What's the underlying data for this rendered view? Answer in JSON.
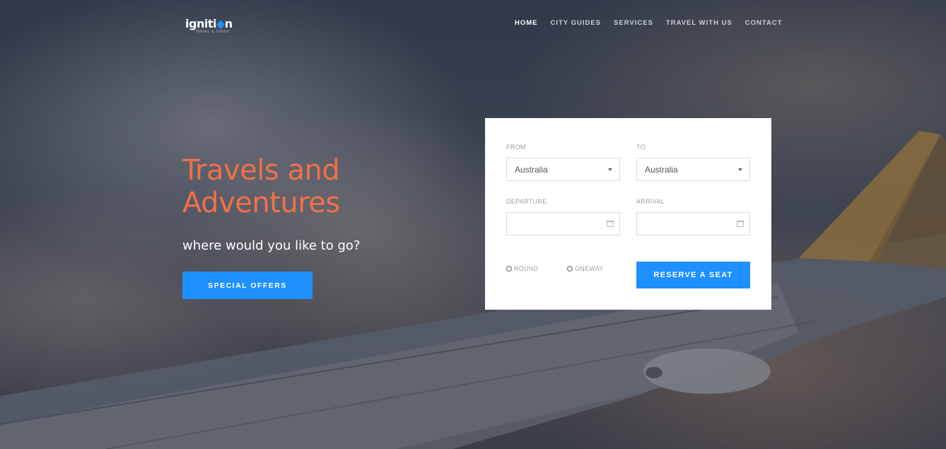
{
  "header": {
    "logo_text_a": "igniti",
    "logo_text_b": "n",
    "logo_tagline": "TRAVEL & TOURS",
    "nav": [
      {
        "label": "HOME",
        "active": true
      },
      {
        "label": "CITY GUIDES",
        "active": false
      },
      {
        "label": "SERVICES",
        "active": false
      },
      {
        "label": "TRAVEL WITH US",
        "active": false
      },
      {
        "label": "CONTACT",
        "active": false
      }
    ]
  },
  "hero": {
    "title_line1": "Travels and",
    "title_line2": "Adventures",
    "subtitle": "where would you like to go?",
    "cta_label": "SPECIAL OFFERS"
  },
  "booking": {
    "from_label": "FROM",
    "from_value": "Australia",
    "to_label": "TO",
    "to_value": "Australia",
    "departure_label": "DEPARTURE",
    "departure_value": "",
    "arrival_label": "ARRIVAL",
    "arrival_value": "",
    "trip_round_label": "ROUND",
    "trip_oneway_label": "ONEWAY",
    "reserve_label": "RESERVE A SEAT"
  },
  "colors": {
    "accent_blue": "#1e90ff",
    "title_orange": "#f26f47"
  }
}
